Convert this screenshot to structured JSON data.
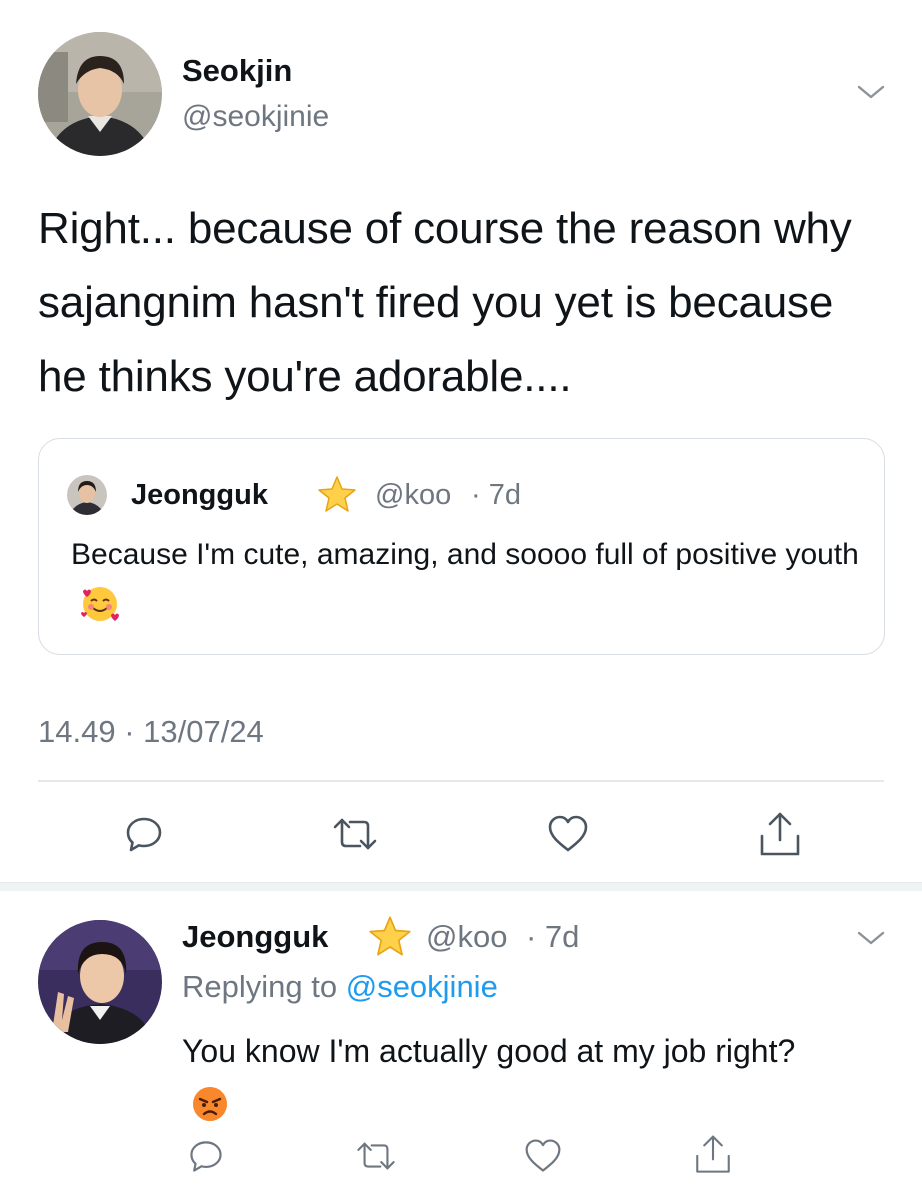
{
  "tweet": {
    "author_name": "Seokjin",
    "author_handle": "@seokjinie",
    "text": "Right... because of course the reason why sajangnim hasn't fired you yet is because he thinks you're adorable....",
    "timestamp": "14.49 · 13/07/24",
    "quoted": {
      "author_name": "Jeongguk",
      "author_handle": "@koo",
      "age": "· 7d",
      "badge_icon": "star-emoji",
      "text": "Because I'm cute, amazing, and soooo full of positive youth",
      "emoji_icon": "smiling-face-with-hearts-emoji"
    },
    "actions": [
      "reply-icon",
      "retweet-icon",
      "like-icon",
      "share-icon"
    ]
  },
  "reply": {
    "author_name": "Jeongguk",
    "author_handle": "@koo",
    "age": "· 7d",
    "badge_icon": "star-emoji",
    "replying_prefix": "Replying to",
    "replying_to": "@seokjinie",
    "text": "You know I'm actually good at my job right?",
    "emoji_icon": "angry-face-emoji",
    "actions": [
      "reply-icon",
      "retweet-icon",
      "like-icon",
      "share-icon"
    ]
  },
  "colors": {
    "link": "#1d9bf0",
    "muted": "#6e7781",
    "divider": "#e6e9ec",
    "separator_band": "#f0f3f4"
  }
}
